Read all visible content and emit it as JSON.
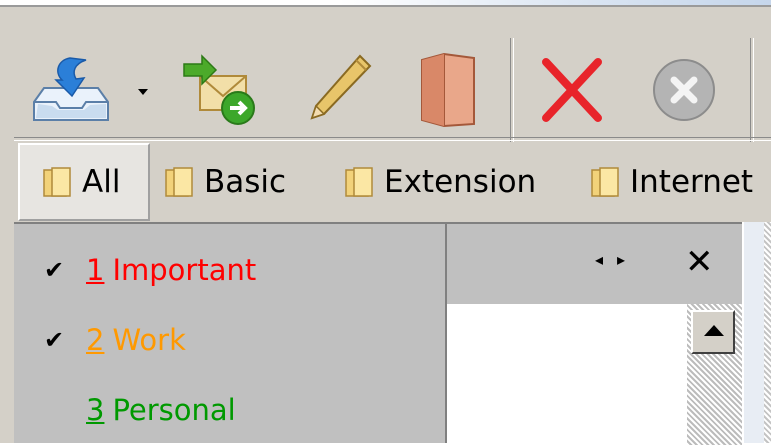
{
  "toolbar": {
    "buttons": [
      {
        "icon": "inbox-download-icon",
        "has_dropdown": true
      },
      {
        "icon": "forward-mail-icon"
      },
      {
        "icon": "pencil-icon"
      },
      {
        "icon": "notebook-icon"
      },
      {
        "icon": "delete-x-icon"
      },
      {
        "icon": "cancel-circle-icon"
      }
    ]
  },
  "tabs": [
    {
      "label": "All",
      "active": true
    },
    {
      "label": "Basic",
      "active": false
    },
    {
      "label": "Extension",
      "active": false
    },
    {
      "label": "Internet",
      "active": false
    }
  ],
  "tags": [
    {
      "num": "1",
      "label": "Important",
      "checked": true,
      "color": "#ff0000"
    },
    {
      "num": "2",
      "label": "Work",
      "checked": true,
      "color": "#ff9900"
    },
    {
      "num": "3",
      "label": "Personal",
      "checked": false,
      "color": "#009900"
    }
  ],
  "colors": {
    "toolbar_bg": "#d4d0c8",
    "panel_bg": "#c0c0c0",
    "important": "#ff0000",
    "work": "#ff9900",
    "personal": "#009900"
  }
}
